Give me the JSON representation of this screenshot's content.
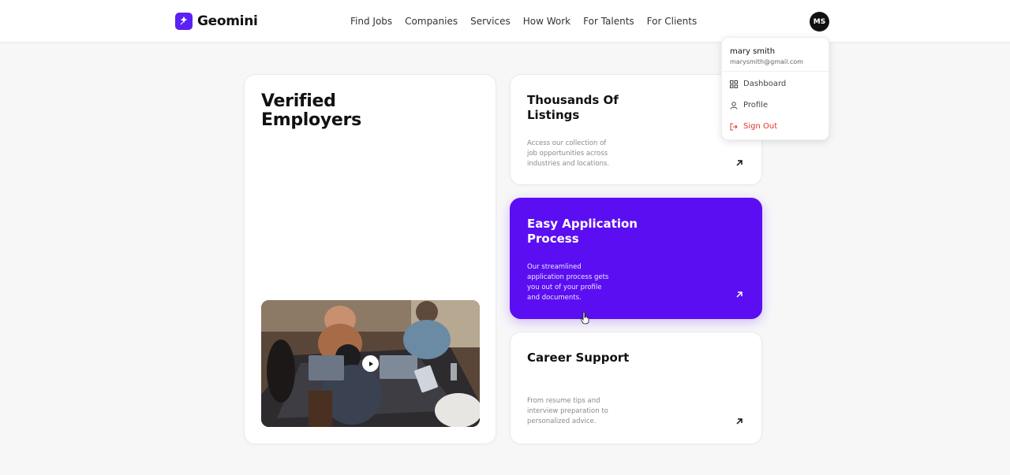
{
  "brand": {
    "name": "Geomini",
    "color": "#5b21f5"
  },
  "nav": {
    "items": [
      "Find Jobs",
      "Companies",
      "Services",
      "How Work",
      "For Talents",
      "For Clients"
    ]
  },
  "user": {
    "initials": "MS",
    "name": "mary smith",
    "email": "marysmith@gmail.com"
  },
  "dropdown": {
    "items": [
      {
        "label": "Dashboard",
        "icon": "dashboard-icon"
      },
      {
        "label": "Profile",
        "icon": "user-icon"
      },
      {
        "label": "Sign Out",
        "icon": "logout-icon",
        "color": "#e0352b"
      }
    ]
  },
  "main": {
    "big_card": {
      "title": "Verified Employers",
      "video_icon": "play-icon"
    },
    "features": [
      {
        "title": "Thousands Of Listings",
        "description": "Access our collection of job opportunities across industries and locations.",
        "icon": "arrow-up-right-icon"
      },
      {
        "title": "Easy Application Process",
        "description": "Our streamlined application process gets you out of your profile and documents.",
        "icon": "arrow-up-right-icon",
        "accent": "#5b0ef2"
      },
      {
        "title": "Career Support",
        "description": "From resume tips and interview preparation to personalized advice.",
        "icon": "arrow-up-right-icon"
      }
    ]
  }
}
